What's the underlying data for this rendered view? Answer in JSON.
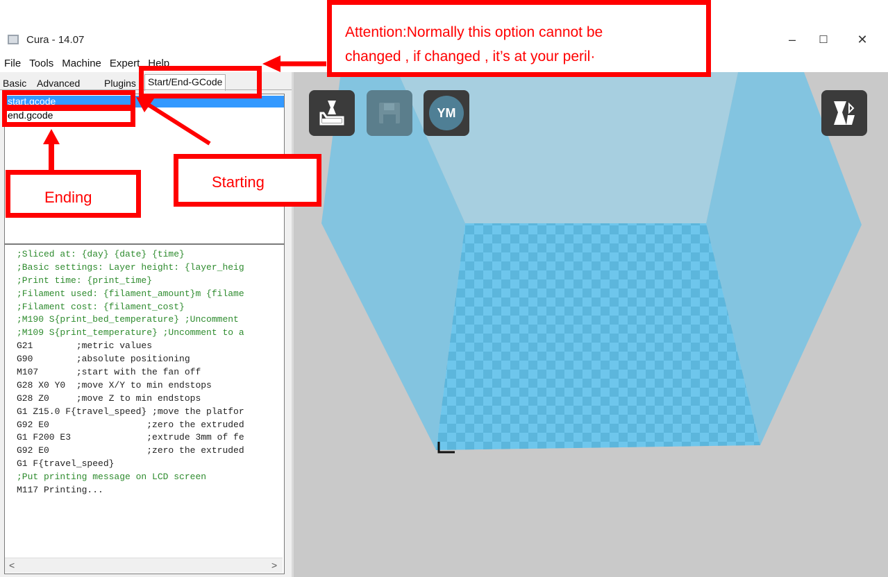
{
  "window": {
    "title": "Cura - 14.07",
    "minimize_glyph": "–",
    "maximize_glyph": "☐",
    "close_glyph": "✕"
  },
  "menu": [
    "File",
    "Tools",
    "Machine",
    "Expert",
    "Help"
  ],
  "tabs": [
    {
      "label": "Basic",
      "active": false
    },
    {
      "label": "Advanced",
      "active": false
    },
    {
      "label": "Plugins",
      "active": false
    },
    {
      "label": "Start/End-GCode",
      "active": true
    }
  ],
  "files": [
    {
      "name": "start.gcode",
      "selected": true
    },
    {
      "name": "end.gcode",
      "selected": false
    }
  ],
  "gcode_lines": [
    {
      "text": ";Sliced at: {day} {date} {time}",
      "kind": "comment"
    },
    {
      "text": ";Basic settings: Layer height: {layer_heig",
      "kind": "comment"
    },
    {
      "text": ";Print time: {print_time}",
      "kind": "comment"
    },
    {
      "text": ";Filament used: {filament_amount}m {filame",
      "kind": "comment"
    },
    {
      "text": ";Filament cost: {filament_cost}",
      "kind": "comment"
    },
    {
      "text": ";M190 S{print_bed_temperature} ;Uncomment",
      "kind": "comment"
    },
    {
      "text": ";M109 S{print_temperature} ;Uncomment to a",
      "kind": "comment"
    },
    {
      "text": "G21        ;metric values",
      "kind": "code"
    },
    {
      "text": "G90        ;absolute positioning",
      "kind": "code"
    },
    {
      "text": "M107       ;start with the fan off",
      "kind": "code"
    },
    {
      "text": "G28 X0 Y0  ;move X/Y to min endstops",
      "kind": "code"
    },
    {
      "text": "G28 Z0     ;move Z to min endstops",
      "kind": "code"
    },
    {
      "text": "G1 Z15.0 F{travel_speed} ;move the platfor",
      "kind": "code"
    },
    {
      "text": "G92 E0                  ;zero the extruded",
      "kind": "code"
    },
    {
      "text": "G1 F200 E3              ;extrude 3mm of fe",
      "kind": "code"
    },
    {
      "text": "G92 E0                  ;zero the extruded",
      "kind": "code"
    },
    {
      "text": "G1 F{travel_speed}",
      "kind": "code"
    },
    {
      "text": ";Put printing message on LCD screen",
      "kind": "comment"
    },
    {
      "text": "M117 Printing...",
      "kind": "code"
    }
  ],
  "scroll": {
    "left": "<",
    "right": ">"
  },
  "toolbar": {
    "load_icon": "load-model-icon",
    "save_icon": "save-gcode-icon",
    "ym_label": "YM",
    "view_icon": "view-mode-icon"
  },
  "annotations": {
    "attention_line1": "Attention:Normally this option cannot be",
    "attention_line2": "changed , if changed , it’s at your peril·",
    "starting": "Starting",
    "ending": "Ending"
  },
  "colors": {
    "annotation_red": "#ff0000",
    "selection_blue": "#3399ff",
    "platform_blue": "#6cc3ea",
    "wall_blue": "#8cc8e2"
  }
}
